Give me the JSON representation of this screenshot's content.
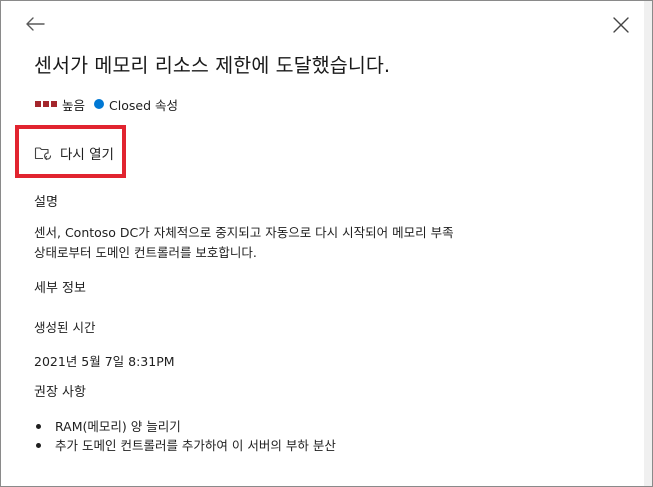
{
  "header": {
    "back_icon": "arrow-left-icon",
    "close_icon": "close-icon"
  },
  "alert": {
    "title": "센서가 메모리 리소스 제한에 도달했습니다.",
    "severity_label": "높음",
    "severity_color": "#a4262c",
    "status_label": "Closed 속성",
    "status_color": "#0078d4"
  },
  "actions": {
    "reopen_label": "다시 열기",
    "reopen_icon": "folder-reopen-icon",
    "highlight_color": "#e1242f"
  },
  "description": {
    "heading": "설명",
    "lines": [
      "센서, Contoso DC가 자체적으로 중지되고 자동으로 다시 시작되어 메모리 부족",
      "상태로부터 도메인 컨트롤러를 보호합니다."
    ]
  },
  "details": {
    "heading": "세부 정보",
    "created_label": "생성된 시간",
    "created_value": "2021년 5월 7일 8:31PM"
  },
  "recommendations": {
    "heading": "권장 사항",
    "items": [
      "RAM(메모리) 양 늘리기",
      "추가 도메인 컨트롤러를 추가하여 이 서버의 부하 분산"
    ]
  }
}
